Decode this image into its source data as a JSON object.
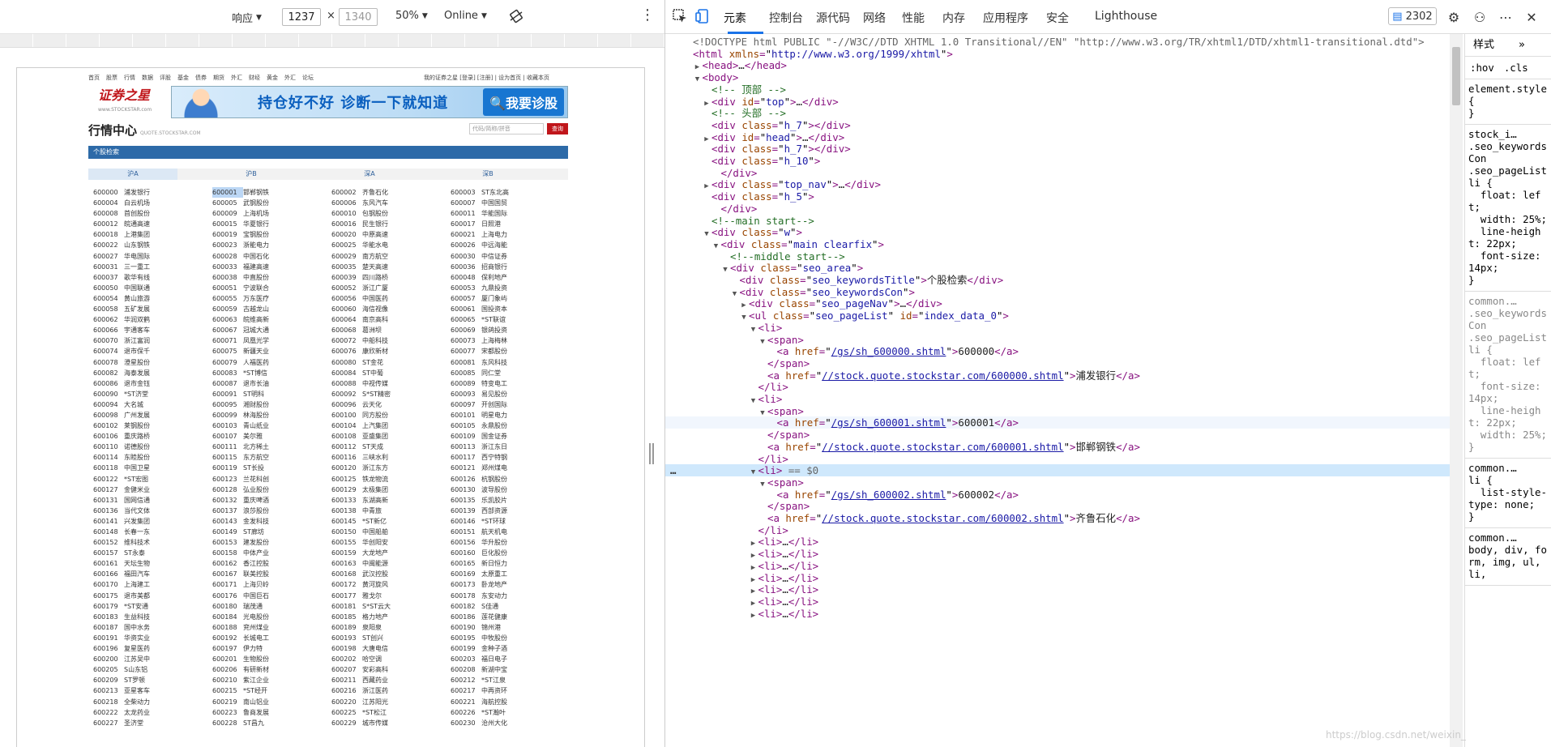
{
  "device_toolbar": {
    "dimension_mode": "响应",
    "width": "1237",
    "times": "×",
    "height": "1340",
    "zoom": "50%",
    "throttle": "Online"
  },
  "mini_page": {
    "top_nav": [
      "首页",
      "股票",
      "行情",
      "数据",
      "评股",
      "基金",
      "债券",
      "期货",
      "外汇",
      "财经",
      "黄金",
      "外汇",
      "论坛"
    ],
    "top_nav_right": "我的证券之星 [登录] [注册] | 设为首页 | 收藏本页",
    "logo": "证券之星",
    "logo_url": "www.STOCKSTAR.com",
    "banner_text": "持仓好不好 诊断一下就知道",
    "banner_button": "我要诊股",
    "title": "行情中心",
    "title_sub": "QUOTE.STOCKSTAR.COM",
    "search_placeholder": "代码/简称/拼音",
    "search_button": "查询",
    "section_title": "个股检索",
    "tabs": [
      "沪A",
      "沪B",
      "深A",
      "深B"
    ],
    "rows": [
      [
        [
          "600000",
          "浦发银行"
        ],
        [
          "600001",
          "邯郸钢铁"
        ],
        [
          "600002",
          "齐鲁石化"
        ],
        [
          "600003",
          "ST东北高"
        ]
      ],
      [
        [
          "600004",
          "白云机场"
        ],
        [
          "600005",
          "武钢股份"
        ],
        [
          "600006",
          "东风汽车"
        ],
        [
          "600007",
          "中国国贸"
        ]
      ],
      [
        [
          "600008",
          "首创股份"
        ],
        [
          "600009",
          "上海机场"
        ],
        [
          "600010",
          "包钢股份"
        ],
        [
          "600011",
          "华能国际"
        ]
      ],
      [
        [
          "600012",
          "皖通高速"
        ],
        [
          "600015",
          "华夏银行"
        ],
        [
          "600016",
          "民生银行"
        ],
        [
          "600017",
          "日照港"
        ]
      ],
      [
        [
          "600018",
          "上港集团"
        ],
        [
          "600019",
          "宝钢股份"
        ],
        [
          "600020",
          "中原高速"
        ],
        [
          "600021",
          "上海电力"
        ]
      ],
      [
        [
          "600022",
          "山东钢铁"
        ],
        [
          "600023",
          "浙能电力"
        ],
        [
          "600025",
          "华能水电"
        ],
        [
          "600026",
          "中远海能"
        ]
      ],
      [
        [
          "600027",
          "华电国际"
        ],
        [
          "600028",
          "中国石化"
        ],
        [
          "600029",
          "南方航空"
        ],
        [
          "600030",
          "中信证券"
        ]
      ],
      [
        [
          "600031",
          "三一重工"
        ],
        [
          "600033",
          "福建高速"
        ],
        [
          "600035",
          "楚天高速"
        ],
        [
          "600036",
          "招商银行"
        ]
      ],
      [
        [
          "600037",
          "歌华有线"
        ],
        [
          "600038",
          "中直股份"
        ],
        [
          "600039",
          "四川路桥"
        ],
        [
          "600048",
          "保利地产"
        ]
      ],
      [
        [
          "600050",
          "中国联通"
        ],
        [
          "600051",
          "宁波联合"
        ],
        [
          "600052",
          "浙江广厦"
        ],
        [
          "600053",
          "九鼎投资"
        ]
      ],
      [
        [
          "600054",
          "黄山旅游"
        ],
        [
          "600055",
          "万东医疗"
        ],
        [
          "600056",
          "中国医药"
        ],
        [
          "600057",
          "厦门象屿"
        ]
      ],
      [
        [
          "600058",
          "五矿发展"
        ],
        [
          "600059",
          "古越龙山"
        ],
        [
          "600060",
          "海信视像"
        ],
        [
          "600061",
          "国投资本"
        ]
      ],
      [
        [
          "600062",
          "华润双鹤"
        ],
        [
          "600063",
          "皖维高新"
        ],
        [
          "600064",
          "南京高科"
        ],
        [
          "600065",
          "*ST联谊"
        ]
      ],
      [
        [
          "600066",
          "宇通客车"
        ],
        [
          "600067",
          "冠城大通"
        ],
        [
          "600068",
          "葛洲坝"
        ],
        [
          "600069",
          "银鸽投资"
        ]
      ],
      [
        [
          "600070",
          "浙江富润"
        ],
        [
          "600071",
          "凤凰光学"
        ],
        [
          "600072",
          "中船科技"
        ],
        [
          "600073",
          "上海梅林"
        ]
      ],
      [
        [
          "600074",
          "退市保千"
        ],
        [
          "600075",
          "新疆天业"
        ],
        [
          "600076",
          "康欣新材"
        ],
        [
          "600077",
          "宋都股份"
        ]
      ],
      [
        [
          "600078",
          "澄星股份"
        ],
        [
          "600079",
          "人福医药"
        ],
        [
          "600080",
          "ST金花"
        ],
        [
          "600081",
          "东风科技"
        ]
      ],
      [
        [
          "600082",
          "海泰发展"
        ],
        [
          "600083",
          "*ST博信"
        ],
        [
          "600084",
          "ST中葡"
        ],
        [
          "600085",
          "同仁堂"
        ]
      ],
      [
        [
          "600086",
          "退市金钰"
        ],
        [
          "600087",
          "退市长油"
        ],
        [
          "600088",
          "中视传媒"
        ],
        [
          "600089",
          "特变电工"
        ]
      ],
      [
        [
          "600090",
          "*ST济堂"
        ],
        [
          "600091",
          "ST明科"
        ],
        [
          "600092",
          "S*ST精密"
        ],
        [
          "600093",
          "易见股份"
        ]
      ],
      [
        [
          "600094",
          "大名城"
        ],
        [
          "600095",
          "湘财股份"
        ],
        [
          "600096",
          "云天化"
        ],
        [
          "600097",
          "开创国际"
        ]
      ],
      [
        [
          "600098",
          "广州发展"
        ],
        [
          "600099",
          "林海股份"
        ],
        [
          "600100",
          "同方股份"
        ],
        [
          "600101",
          "明星电力"
        ]
      ],
      [
        [
          "600102",
          "莱钢股份"
        ],
        [
          "600103",
          "青山纸业"
        ],
        [
          "600104",
          "上汽集团"
        ],
        [
          "600105",
          "永鼎股份"
        ]
      ],
      [
        [
          "600106",
          "重庆路桥"
        ],
        [
          "600107",
          "美尔雅"
        ],
        [
          "600108",
          "亚盛集团"
        ],
        [
          "600109",
          "国金证券"
        ]
      ],
      [
        [
          "600110",
          "诺德股份"
        ],
        [
          "600111",
          "北方稀土"
        ],
        [
          "600112",
          "ST天成"
        ],
        [
          "600113",
          "浙江东日"
        ]
      ],
      [
        [
          "600114",
          "东睦股份"
        ],
        [
          "600115",
          "东方航空"
        ],
        [
          "600116",
          "三峡水利"
        ],
        [
          "600117",
          "西宁特钢"
        ]
      ],
      [
        [
          "600118",
          "中国卫星"
        ],
        [
          "600119",
          "ST长投"
        ],
        [
          "600120",
          "浙江东方"
        ],
        [
          "600121",
          "郑州煤电"
        ]
      ],
      [
        [
          "600122",
          "*ST宏图"
        ],
        [
          "600123",
          "兰花科创"
        ],
        [
          "600125",
          "铁龙物流"
        ],
        [
          "600126",
          "杭钢股份"
        ]
      ],
      [
        [
          "600127",
          "金健米业"
        ],
        [
          "600128",
          "弘业股份"
        ],
        [
          "600129",
          "太极集团"
        ],
        [
          "600130",
          "波导股份"
        ]
      ],
      [
        [
          "600131",
          "国网信通"
        ],
        [
          "600132",
          "重庆啤酒"
        ],
        [
          "600133",
          "东湖高新"
        ],
        [
          "600135",
          "乐凯胶片"
        ]
      ],
      [
        [
          "600136",
          "当代文体"
        ],
        [
          "600137",
          "浪莎股份"
        ],
        [
          "600138",
          "中青旅"
        ],
        [
          "600139",
          "西部资源"
        ]
      ],
      [
        [
          "600141",
          "兴发集团"
        ],
        [
          "600143",
          "金发科技"
        ],
        [
          "600145",
          "*ST新亿"
        ],
        [
          "600146",
          "*ST环球"
        ]
      ],
      [
        [
          "600148",
          "长春一东"
        ],
        [
          "600149",
          "ST廊坊"
        ],
        [
          "600150",
          "中国船舶"
        ],
        [
          "600151",
          "航天机电"
        ]
      ],
      [
        [
          "600152",
          "维科技术"
        ],
        [
          "600153",
          "建发股份"
        ],
        [
          "600155",
          "华创阳安"
        ],
        [
          "600156",
          "华升股份"
        ]
      ],
      [
        [
          "600157",
          "ST永泰"
        ],
        [
          "600158",
          "中体产业"
        ],
        [
          "600159",
          "大龙地产"
        ],
        [
          "600160",
          "巨化股份"
        ]
      ],
      [
        [
          "600161",
          "天坛生物"
        ],
        [
          "600162",
          "香江控股"
        ],
        [
          "600163",
          "中闽能源"
        ],
        [
          "600165",
          "新日恒力"
        ]
      ],
      [
        [
          "600166",
          "福田汽车"
        ],
        [
          "600167",
          "联美控股"
        ],
        [
          "600168",
          "武汉控股"
        ],
        [
          "600169",
          "太原重工"
        ]
      ],
      [
        [
          "600170",
          "上海建工"
        ],
        [
          "600171",
          "上海贝岭"
        ],
        [
          "600172",
          "黄河旋风"
        ],
        [
          "600173",
          "卧龙地产"
        ]
      ],
      [
        [
          "600175",
          "退市美都"
        ],
        [
          "600176",
          "中国巨石"
        ],
        [
          "600177",
          "雅戈尔"
        ],
        [
          "600178",
          "东安动力"
        ]
      ],
      [
        [
          "600179",
          "*ST安通"
        ],
        [
          "600180",
          "瑞茂通"
        ],
        [
          "600181",
          "S*ST云大"
        ],
        [
          "600182",
          "S佳通"
        ]
      ],
      [
        [
          "600183",
          "生益科技"
        ],
        [
          "600184",
          "光电股份"
        ],
        [
          "600185",
          "格力地产"
        ],
        [
          "600186",
          "莲花健康"
        ]
      ],
      [
        [
          "600187",
          "国中水务"
        ],
        [
          "600188",
          "兖州煤业"
        ],
        [
          "600189",
          "泉阳泉"
        ],
        [
          "600190",
          "锦州港"
        ]
      ],
      [
        [
          "600191",
          "华资实业"
        ],
        [
          "600192",
          "长城电工"
        ],
        [
          "600193",
          "ST创兴"
        ],
        [
          "600195",
          "中牧股份"
        ]
      ],
      [
        [
          "600196",
          "复星医药"
        ],
        [
          "600197",
          "伊力特"
        ],
        [
          "600198",
          "大唐电信"
        ],
        [
          "600199",
          "金种子酒"
        ]
      ],
      [
        [
          "600200",
          "江苏吴中"
        ],
        [
          "600201",
          "生物股份"
        ],
        [
          "600202",
          "哈空调"
        ],
        [
          "600203",
          "福日电子"
        ]
      ],
      [
        [
          "600205",
          "S山东铝"
        ],
        [
          "600206",
          "有研新材"
        ],
        [
          "600207",
          "安彩高科"
        ],
        [
          "600208",
          "新湖中宝"
        ]
      ],
      [
        [
          "600209",
          "ST罗顿"
        ],
        [
          "600210",
          "紫江企业"
        ],
        [
          "600211",
          "西藏药业"
        ],
        [
          "600212",
          "*ST江泉"
        ]
      ],
      [
        [
          "600213",
          "亚星客车"
        ],
        [
          "600215",
          "*ST经开"
        ],
        [
          "600216",
          "浙江医药"
        ],
        [
          "600217",
          "中再资环"
        ]
      ],
      [
        [
          "600218",
          "全柴动力"
        ],
        [
          "600219",
          "南山铝业"
        ],
        [
          "600220",
          "江苏阳光"
        ],
        [
          "600221",
          "海航控股"
        ]
      ],
      [
        [
          "600222",
          "太龙药业"
        ],
        [
          "600223",
          "鲁商发展"
        ],
        [
          "600225",
          "*ST松江"
        ],
        [
          "600226",
          "*ST瀚叶"
        ]
      ],
      [
        [
          "600227",
          "圣济堂"
        ],
        [
          "600228",
          "ST昌九"
        ],
        [
          "600229",
          "城市传媒"
        ],
        [
          "600230",
          "沧州大化"
        ]
      ]
    ]
  },
  "devtools": {
    "tabs": [
      "元素",
      "控制台",
      "源代码",
      "网络",
      "性能",
      "内存",
      "应用程序",
      "安全",
      "Lighthouse"
    ],
    "issues_count": "2302",
    "dom_lines": [
      "<!DOCTYPE html PUBLIC \"-//W3C//DTD XHTML 1.0 Transitional//EN\" \"http://www.w3.org/TR/xhtml1/DTD/xhtml1-transitional.dtd\">",
      "<html xmlns=\"http://www.w3.org/1999/xhtml\">",
      "<head>…</head>",
      "<body>",
      "<!-- 顶部 -->",
      "<div id=\"top\">…</div>",
      "<!-- 头部 -->",
      "<div class=\"h_7\"></div>",
      "<div id=\"head\">…</div>",
      "<div class=\"h_7\"></div>",
      "<div class=\"h_10\">",
      "</div>",
      "<div class=\"top_nav\">…</div>",
      "<div class=\"h_5\">",
      "</div>",
      "<!--main start-->",
      "<div class=\"w\">",
      "<div class=\"main clearfix\">",
      "<!--middle start-->",
      "<div class=\"seo_area\">",
      "<div class=\"seo_keywordsTitle\">个股检索</div>",
      "<div class=\"seo_keywordsCon\">",
      "<div class=\"seo_pageNav\">…</div>",
      "<ul class=\"seo_pageList\" id=\"index_data_0\">",
      "<li>",
      "<span>",
      "<a href=\"/gs/sh_600000.shtml\">600000</a>",
      "</span>",
      "<a href=\"//stock.quote.stockstar.com/600000.shtml\">浦发银行</a>",
      "</li>",
      "<li>",
      "<span>",
      "<a href=\"/gs/sh_600001.shtml\">600001</a>",
      "</span>",
      "<a href=\"//stock.quote.stockstar.com/600001.shtml\">邯郸钢铁</a>",
      "</li>",
      "<li> == $0",
      "<span>",
      "<a href=\"/gs/sh_600002.shtml\">600002</a>",
      "</span>",
      "<a href=\"//stock.quote.stockstar.com/600002.shtml\">齐鲁石化</a>",
      "</li>",
      "<li>…</li>",
      "<li>…</li>",
      "<li>…</li>",
      "<li>…</li>",
      "<li>…</li>",
      "<li>…</li>",
      "<li>…</li>"
    ],
    "styles_tabs": [
      "样式",
      "»"
    ],
    "styles_filter": [
      ":hov",
      ".cls"
    ],
    "style_rules": [
      "element.style {\n}",
      "stock_i…\n.seo_keywordsCon\n.seo_pageList li {\n  float: left;\n  width: 25%;\n  line-height: 22px;\n  font-size: 14px;\n}",
      "common.…\n.seo_keywordsCon\n.seo_pageList li {\n  float: left;\n  font-size: 14px;\n  line-height: 22px;\n  width: 25%;\n}",
      "common.…\nli {\n  list-style-type: none;\n}",
      "common.…\nbody, div, form, img, ul, li,"
    ],
    "watermark": "https://blog.csdn.net/weixin_"
  }
}
